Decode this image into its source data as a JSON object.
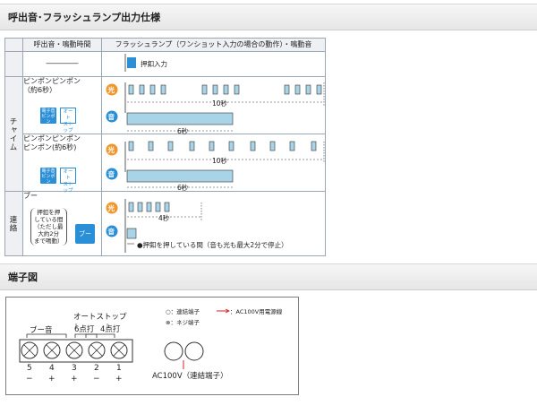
{
  "headers": {
    "spec": "呼出音･フラッシュランプ出力仕様",
    "terminal": "端子図"
  },
  "table": {
    "col1": "呼出音・鳴動時間",
    "col2": "フラッシュランプ（ワンショット入力の場合の動作）・鳴動音",
    "first_row_sound": "――――",
    "press_input": "押釦入力",
    "chime_label": "チャイム",
    "chime_a_text": [
      "ピンポンピンポン",
      "（約6秒）"
    ],
    "chime_a_icon": [
      "電子音",
      "ピンポン",
      "2回"
    ],
    "chime_b_text": [
      "ピンポンピンポン",
      "ピンポン(約6秒)"
    ],
    "chime_b_icon": [
      "電子音",
      "ピンポン",
      "3回"
    ],
    "auto_stop": [
      "オート",
      "ストップ"
    ],
    "renraku_label": "連絡",
    "boo_text": "ブー",
    "boo_paren": [
      "押釦を押",
      "している間",
      "（ただし最",
      "大約2分",
      "まで鳴動）"
    ],
    "boo_icon": "ブー",
    "light_badge": "光",
    "sound_badge": "音",
    "dur_10": "10秒",
    "dur_6": "6秒",
    "dur_4": "4秒",
    "note": "●押釦を押している間（音も光も最大2分で停止）"
  },
  "terminal": {
    "boo": "ブー音",
    "autostop": "オートストップ",
    "p6": "6点打",
    "p4": "4点打",
    "nums": [
      "5",
      "4",
      "3",
      "2",
      "1"
    ],
    "signs": [
      "−",
      "+",
      "+",
      "−",
      "+"
    ],
    "ac": "AC100V（連結端子）",
    "legend_connect": "○：連結端子",
    "legend_screw": "⊗：ネジ端子",
    "legend_power": "：AC100V用電源線"
  },
  "colors": {
    "accent": "#2a8fd6",
    "pulse_fill": "#a9d3e6",
    "badge_orange": "#f0962c",
    "power_red": "#d62222"
  }
}
